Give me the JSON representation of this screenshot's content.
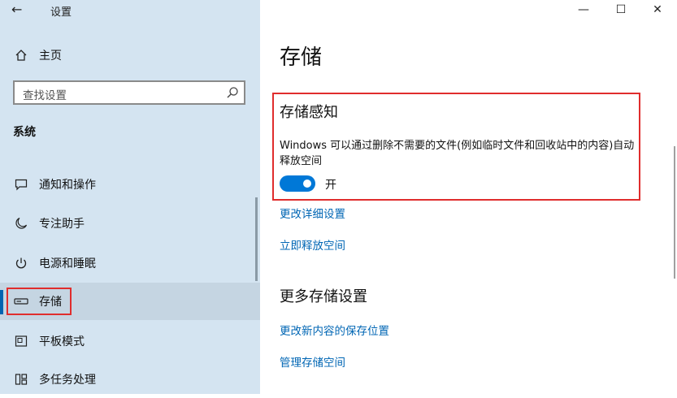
{
  "window": {
    "title": "设置",
    "back_icon": "←",
    "minimize_icon": "—",
    "maximize_icon": "☐",
    "close_icon": "✕"
  },
  "sidebar": {
    "home_label": "主页",
    "search": {
      "placeholder": "查找设置"
    },
    "section_label": "系统",
    "items": [
      {
        "label": "通知和操作",
        "icon": "notification-icon"
      },
      {
        "label": "专注助手",
        "icon": "moon-icon"
      },
      {
        "label": "电源和睡眠",
        "icon": "power-icon"
      },
      {
        "label": "存储",
        "icon": "storage-icon",
        "selected": true
      },
      {
        "label": "平板模式",
        "icon": "tablet-mode-icon"
      },
      {
        "label": "多任务处理",
        "icon": "multitasking-icon"
      }
    ]
  },
  "main": {
    "page_title": "存储",
    "storage_sense": {
      "title": "存储感知",
      "description": "Windows 可以通过删除不需要的文件(例如临时文件和回收站中的内容)自动释放空间",
      "toggle_state": "开",
      "toggle_on": true
    },
    "links1": [
      "更改详细设置",
      "立即释放空间"
    ],
    "more_title": "更多存储设置",
    "links2": [
      "更改新内容的保存位置",
      "管理存储空间"
    ]
  },
  "colors": {
    "sidebar_bg": "#d4e4f1",
    "accent": "#0078d7",
    "link": "#0066b4",
    "highlight_box": "#e02d2d"
  }
}
